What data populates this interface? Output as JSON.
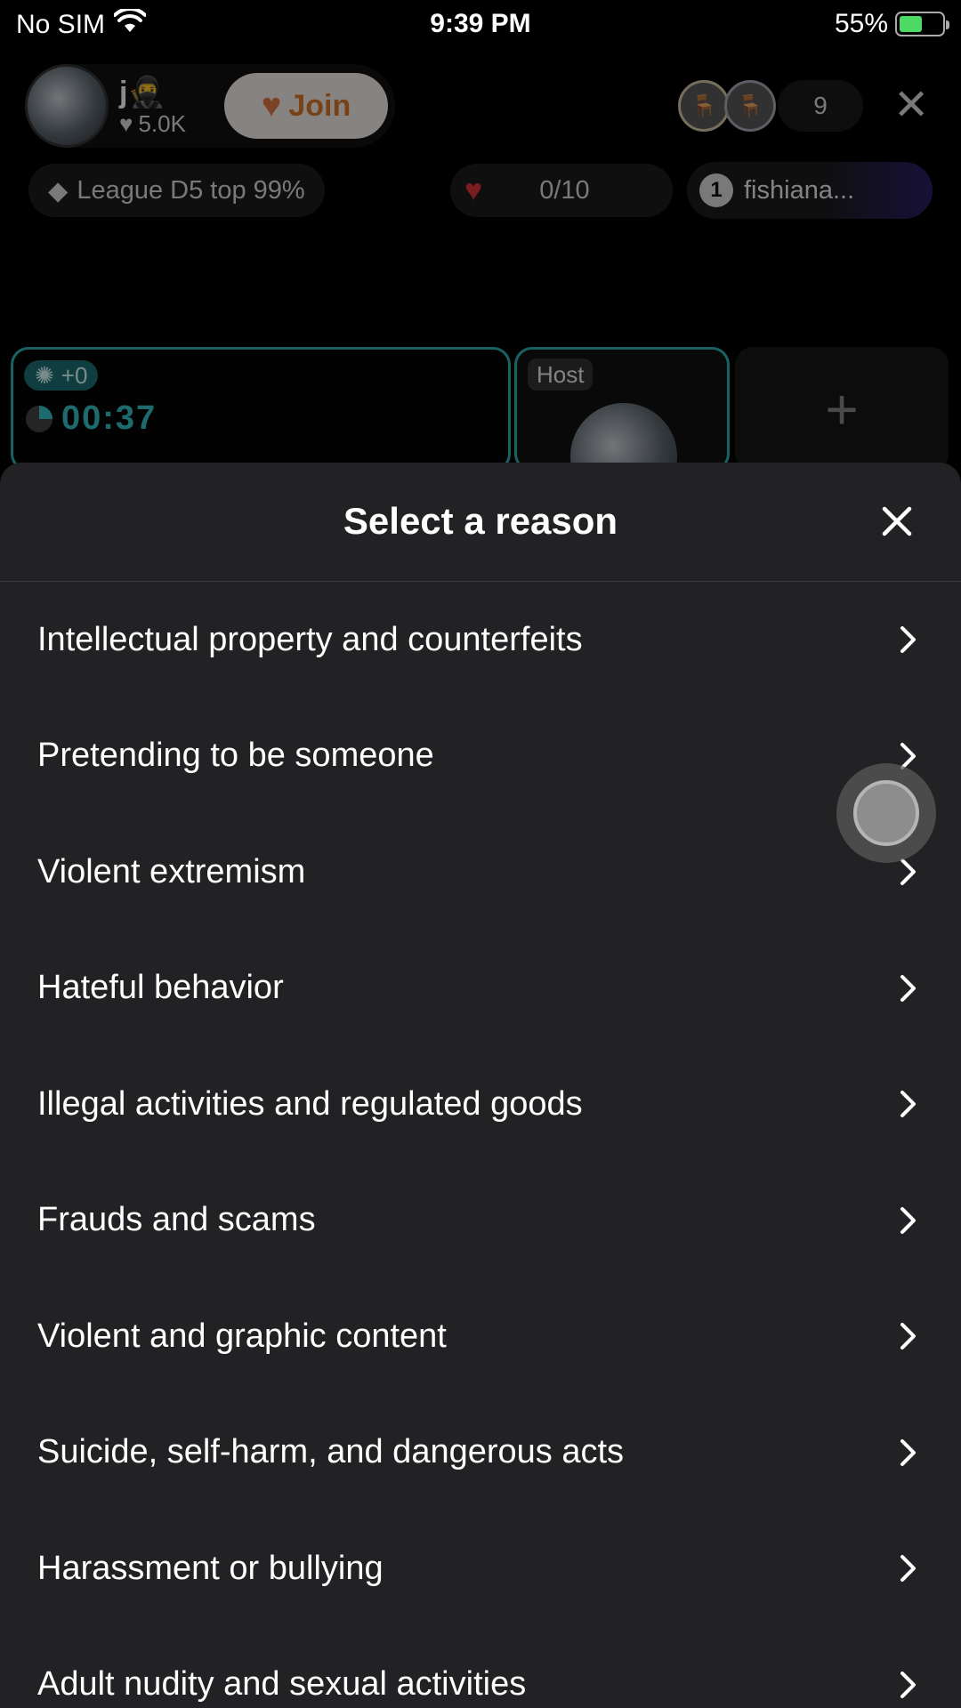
{
  "status_bar": {
    "carrier": "No SIM",
    "time": "9:39 PM",
    "battery": "55%",
    "battery_level": 0.55
  },
  "room_header": {
    "host_name": "j🥷",
    "host_likes": "5.0K",
    "join_label": "Join",
    "viewer_count": "9",
    "league_label": "League D5 top 99%",
    "gift_progress": "0/10",
    "rank_number": "1",
    "rank_user": "fishiana..."
  },
  "battle": {
    "score_badge": "+0",
    "timer": "00:37",
    "host_tag": "Host"
  },
  "sheet": {
    "title": "Select a reason",
    "reasons": [
      "Intellectual property and counterfeits",
      "Pretending to be someone",
      "Violent extremism",
      "Hateful behavior",
      "Illegal activities and regulated goods",
      "Frauds and scams",
      "Violent and graphic content",
      "Suicide, self-harm, and dangerous acts",
      "Harassment or bullying",
      "Adult nudity and sexual activities"
    ]
  },
  "icons": {
    "wifi": "wifi-icon",
    "battery": "battery-charging-icon",
    "heart": "heart-icon",
    "diamond": "diamond-icon",
    "close": "close-icon",
    "chevron": "chevron-right-icon"
  },
  "colors": {
    "accent_teal": "#2fb3b6",
    "join_text": "#d9792b",
    "sheet_background": "#222124"
  }
}
